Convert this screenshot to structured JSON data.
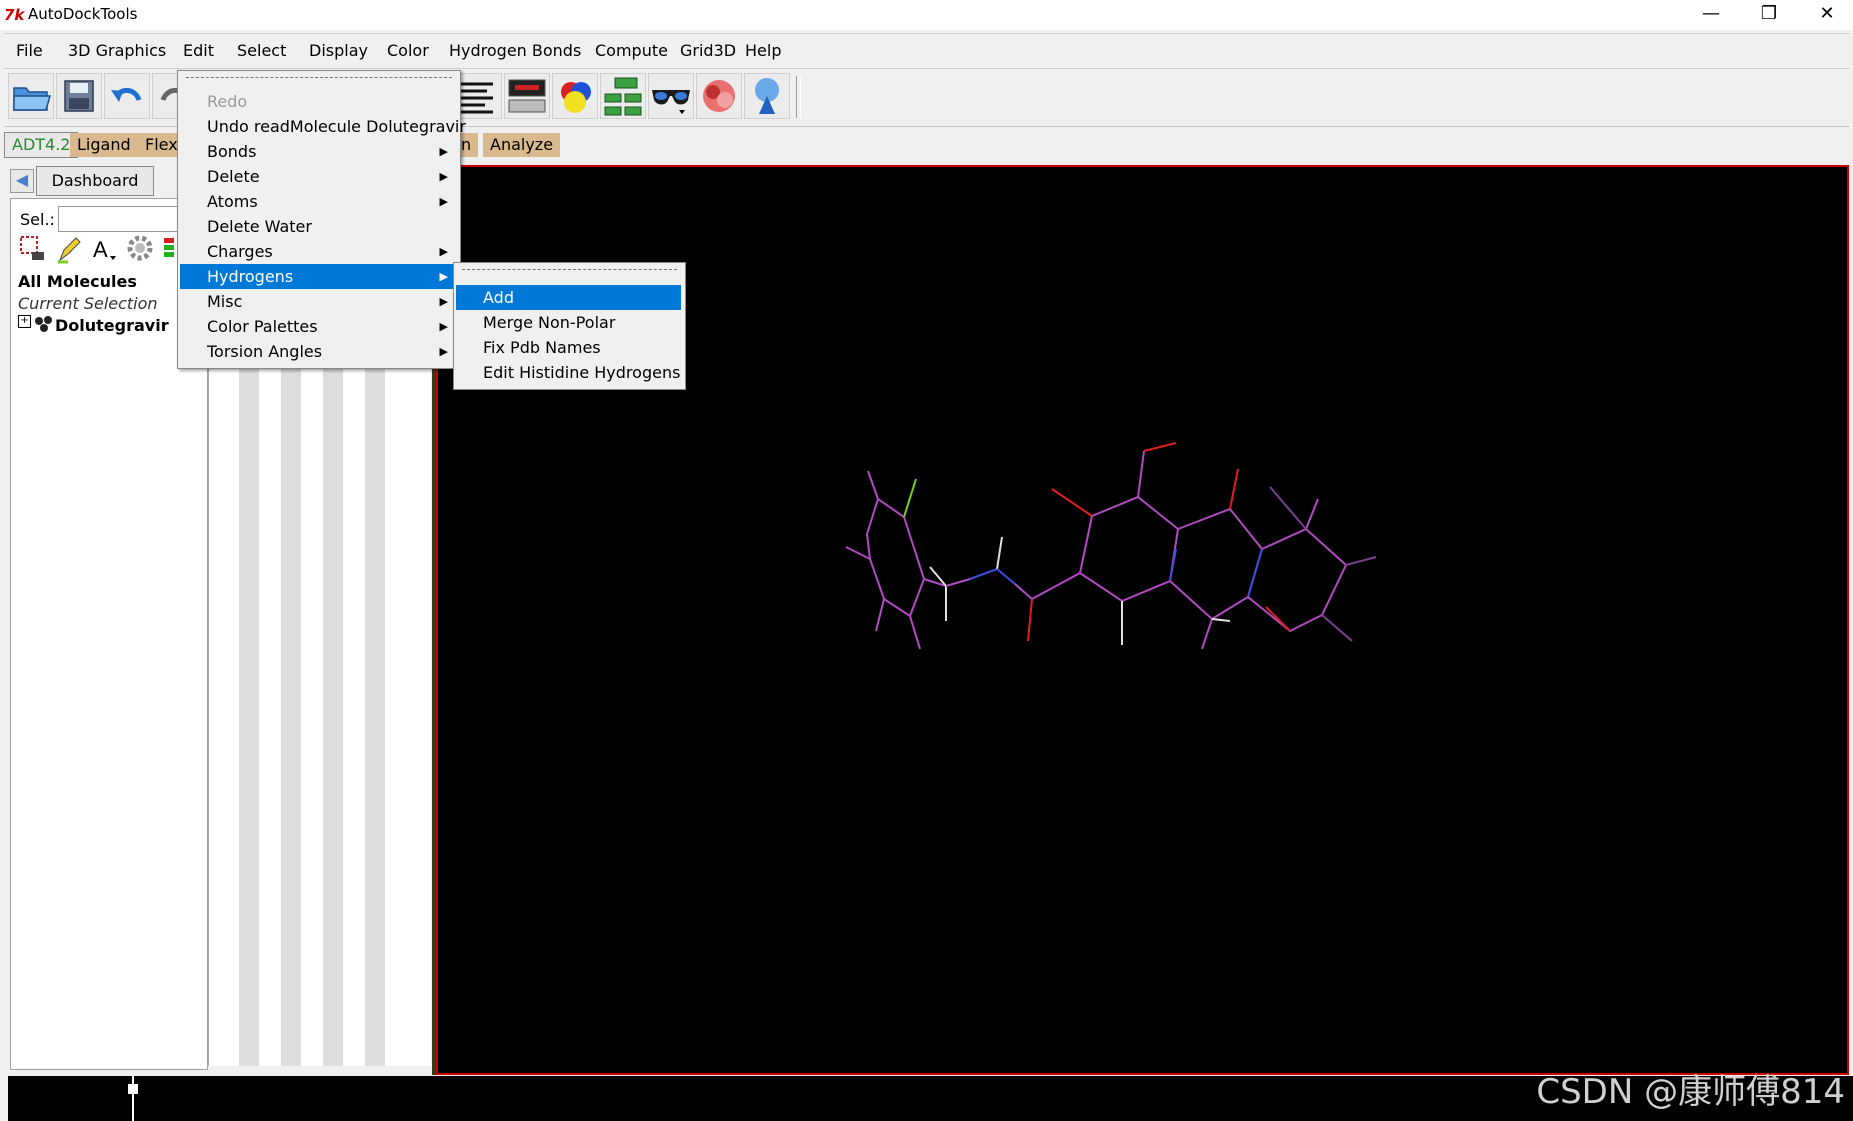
{
  "window": {
    "title": "AutoDockTools",
    "icon_text": "7k",
    "minimize": "—",
    "restore": "❐",
    "close": "✕"
  },
  "menubar": {
    "items": [
      "File",
      "3D Graphics",
      "Edit",
      "Select",
      "Display",
      "Color",
      "Hydrogen Bonds",
      "Compute",
      "Grid3D",
      "Help"
    ]
  },
  "module_tabs": {
    "items": [
      "ADT4.2",
      "Ligand",
      "Flex",
      "n",
      "Analyze"
    ]
  },
  "dashboard": {
    "back_icon": "◀",
    "tab_label": "Dashboard",
    "sel_label": "Sel.:",
    "sel_value": "",
    "tree": {
      "all_molecules": "All Molecules",
      "current_selection": "Current Selection",
      "expand": "+",
      "molecule": "Dolutegravir"
    }
  },
  "edit_menu": {
    "items": [
      {
        "label": "Redo",
        "disabled": true,
        "submenu": false
      },
      {
        "label": "Undo readMolecule Dolutegravir",
        "submenu": false
      },
      {
        "label": "Bonds",
        "submenu": true
      },
      {
        "label": "Delete",
        "submenu": true
      },
      {
        "label": "Atoms",
        "submenu": true
      },
      {
        "label": "Delete Water",
        "submenu": false
      },
      {
        "label": "Charges",
        "submenu": true
      },
      {
        "label": "Hydrogens",
        "submenu": true,
        "active": true
      },
      {
        "label": "Misc",
        "submenu": true
      },
      {
        "label": "Color Palettes",
        "submenu": true
      },
      {
        "label": "Torsion Angles",
        "submenu": true
      }
    ],
    "arrow": "▶"
  },
  "hydrogens_menu": {
    "items": [
      {
        "label": "Add",
        "active": true
      },
      {
        "label": "Merge Non-Polar"
      },
      {
        "label": "Fix Pdb Names"
      },
      {
        "label": "Edit Histidine Hydrogens"
      }
    ]
  },
  "watermark": "CSDN @康师傅814",
  "colors": {
    "accent": "#0078d7",
    "tab_bg": "#d9b98d",
    "viewer_border": "#cc0000",
    "bond_carbon": "#b04cc0",
    "bond_nitrogen": "#3a4fe0",
    "bond_oxygen": "#e02020",
    "bond_fluorine": "#7ad020",
    "bond_hydrogen": "#e0e0e0"
  }
}
